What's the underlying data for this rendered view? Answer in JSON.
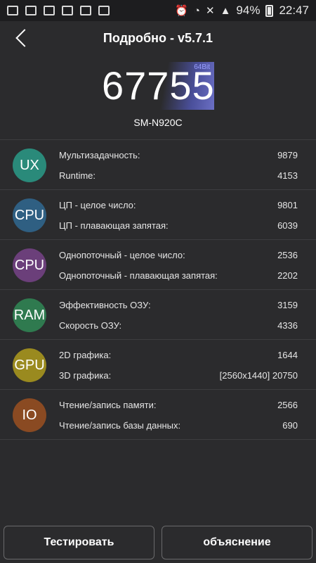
{
  "status_bar": {
    "battery": "94%",
    "time": "22:47",
    "left_icons": [
      "photo-icon",
      "gallery-icon",
      "mail-icon",
      "store-icon",
      "store-icon",
      "clipboard-icon"
    ],
    "right_icons": [
      "alarm-icon",
      "wifi-icon",
      "mute-icon",
      "signal-icon",
      "battery-icon"
    ]
  },
  "header": {
    "title": "Подробно - v5.7.1"
  },
  "score": {
    "value": "67755",
    "bits": "64Bit",
    "device": "SM-N920C"
  },
  "rows": [
    {
      "badge": "UX",
      "color": "#2a8a7a",
      "items": [
        {
          "label": "Мультизадачность:",
          "value": "9879"
        },
        {
          "label": "Runtime:",
          "value": "4153"
        }
      ]
    },
    {
      "badge": "CPU",
      "color": "#2f5f82",
      "items": [
        {
          "label": "ЦП - целое число:",
          "value": "9801"
        },
        {
          "label": "ЦП - плавающая запятая:",
          "value": "6039"
        }
      ]
    },
    {
      "badge": "CPU",
      "color": "#6b3f7a",
      "items": [
        {
          "label": "Однопоточный - целое число:",
          "value": "2536"
        },
        {
          "label": "Однопоточный - плавающая запятая:",
          "value": "2202"
        }
      ]
    },
    {
      "badge": "RAM",
      "color": "#2f7a4f",
      "items": [
        {
          "label": "Эффективность ОЗУ:",
          "value": "3159"
        },
        {
          "label": "Скорость ОЗУ:",
          "value": "4336"
        }
      ]
    },
    {
      "badge": "GPU",
      "color": "#9a8a1f",
      "items": [
        {
          "label": "2D графика:",
          "value": "1644"
        },
        {
          "label": "3D графика:",
          "value": "[2560x1440] 20750"
        }
      ]
    },
    {
      "badge": "IO",
      "color": "#8a4a22",
      "items": [
        {
          "label": "Чтение/запись памяти:",
          "value": "2566"
        },
        {
          "label": "Чтение/запись базы данных:",
          "value": "690"
        }
      ]
    }
  ],
  "buttons": {
    "test": "Тестировать",
    "explain": "объяснение"
  }
}
